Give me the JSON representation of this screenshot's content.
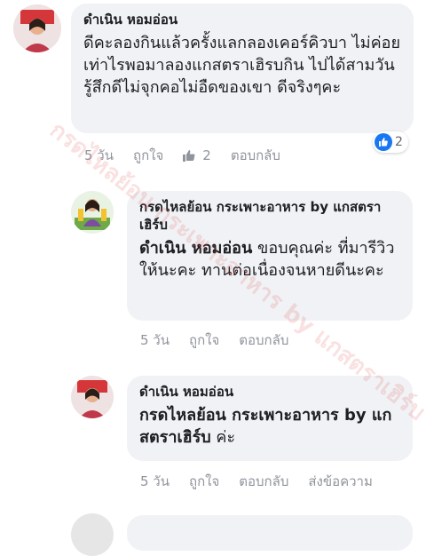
{
  "comments": [
    {
      "author": "ดำเนิน หอมอ่อน",
      "text": "ดีคะลองกินแล้วครั้งแลกลองเคอร์คิวบา ไม่ค่อยเท่าไรพอมาลองแกสตราเฮิรบกิน ไปได้สามวันรู้สึกดีไม่จุกคอไม่อืดของเขา ดีจริงๆคะ",
      "time": "5 วัน",
      "like_label": "ถูกใจ",
      "like_count": "2",
      "reply_label": "ตอบกลับ",
      "reaction_count": "2"
    },
    {
      "author": "กรดไหลย้อน กระเพาะอาหาร by แกสตราเฮิร์บ",
      "mention": "ดำเนิน หอมอ่อน",
      "text": "ขอบคุณค่ะ ที่มารีวิวให้นะคะ ทานต่อเนื่องจนหายดีนะคะ",
      "time": "5 วัน",
      "like_label": "ถูกใจ",
      "reply_label": "ตอบกลับ"
    },
    {
      "author": "ดำเนิน หอมอ่อน",
      "mention": "กรดไหลย้อน กระเพาะอาหาร by แกสตราเฮิร์บ",
      "text": "ค่ะ",
      "time": "5 วัน",
      "like_label": "ถูกใจ",
      "reply_label": "ตอบกลับ",
      "message_label": "ส่งข้อความ"
    }
  ],
  "watermark": "กรดไหลย้อน กระเพาะอาหาร by แกสตราเฮิร์บ",
  "colors": {
    "bubble": "#f0f2f5",
    "meta_text": "#90949c",
    "like_blue": "#1877f2"
  }
}
